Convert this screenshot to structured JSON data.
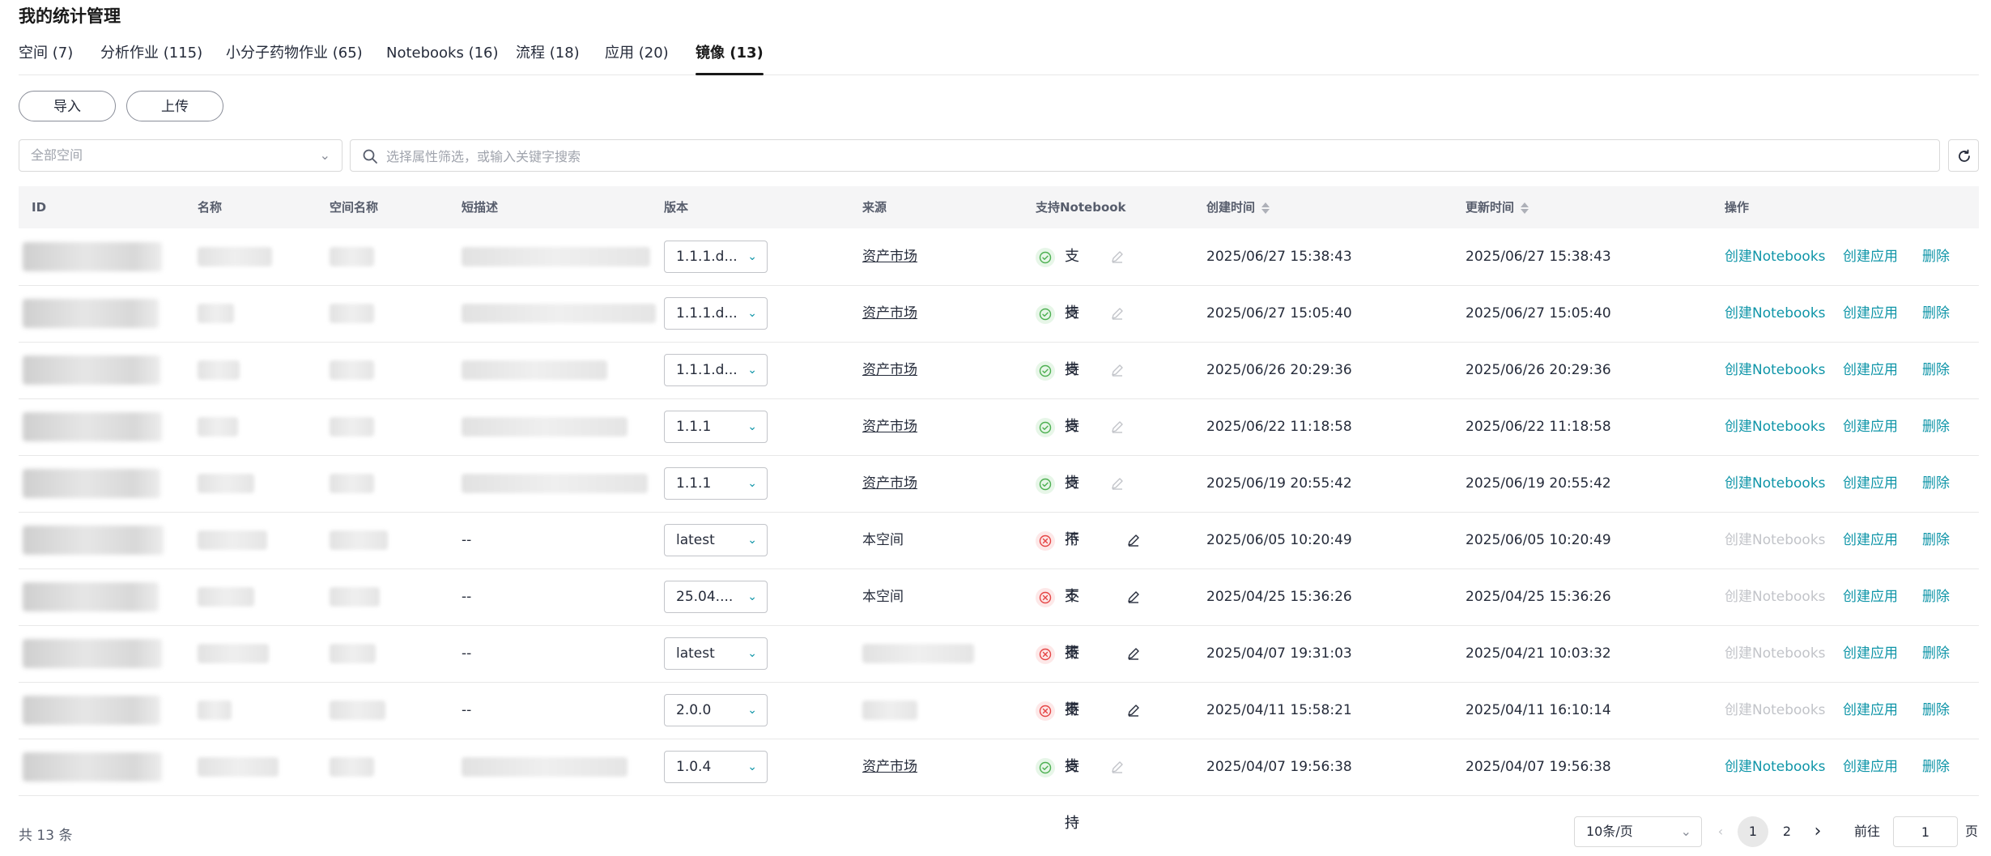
{
  "page": {
    "title": "我的统计管理"
  },
  "tabs": [
    {
      "label": "空间 (7)"
    },
    {
      "label": "分析作业 (115)"
    },
    {
      "label": "小分子药物作业 (65)"
    },
    {
      "label": "Notebooks (16)"
    },
    {
      "label": "流程 (18)"
    },
    {
      "label": "应用 (20)"
    },
    {
      "label": "镜像 (13)",
      "active": true
    }
  ],
  "toolbar": {
    "import_label": "导入",
    "upload_label": "上传"
  },
  "filters": {
    "space_placeholder": "全部空间",
    "search_placeholder": "选择属性筛选，或输入关键字搜索"
  },
  "table": {
    "headers": {
      "id": "ID",
      "name": "名称",
      "space": "空间名称",
      "desc": "短描述",
      "version": "版本",
      "source": "来源",
      "notebook": "支持Notebook",
      "created": "创建时间",
      "updated": "更新时间",
      "ops": "操作"
    },
    "actions": {
      "create_notebooks": "创建Notebooks",
      "create_app": "创建应用",
      "delete": "删除"
    },
    "rows": [
      {
        "desc": "",
        "version": "1.1.1.d...",
        "source": "资产市场",
        "source_link": true,
        "supported": true,
        "notebook": "支持",
        "created": "2025/06/27 15:38:43",
        "updated": "2025/06/27 15:38:43"
      },
      {
        "desc": "",
        "version": "1.1.1.d...",
        "source": "资产市场",
        "source_link": true,
        "supported": true,
        "notebook": "支持",
        "created": "2025/06/27 15:05:40",
        "updated": "2025/06/27 15:05:40"
      },
      {
        "desc": "",
        "version": "1.1.1.d...",
        "source": "资产市场",
        "source_link": true,
        "supported": true,
        "notebook": "支持",
        "created": "2025/06/26 20:29:36",
        "updated": "2025/06/26 20:29:36"
      },
      {
        "desc": "",
        "version": "1.1.1",
        "source": "资产市场",
        "source_link": true,
        "supported": true,
        "notebook": "支持",
        "created": "2025/06/22 11:18:58",
        "updated": "2025/06/22 11:18:58"
      },
      {
        "desc": "",
        "version": "1.1.1",
        "source": "资产市场",
        "source_link": true,
        "supported": true,
        "notebook": "支持",
        "created": "2025/06/19 20:55:42",
        "updated": "2025/06/19 20:55:42"
      },
      {
        "desc": "--",
        "version": "latest",
        "source": "本空间",
        "source_link": false,
        "supported": false,
        "notebook": "不支持",
        "created": "2025/06/05 10:20:49",
        "updated": "2025/06/05 10:20:49"
      },
      {
        "desc": "--",
        "version": "25.04....",
        "source": "本空间",
        "source_link": false,
        "supported": false,
        "notebook": "不支持",
        "created": "2025/04/25 15:36:26",
        "updated": "2025/04/25 15:36:26"
      },
      {
        "desc": "--",
        "version": "latest",
        "source": "",
        "source_link": false,
        "supported": false,
        "notebook": "不支持",
        "created": "2025/04/07 19:31:03",
        "updated": "2025/04/21 10:03:32"
      },
      {
        "desc": "--",
        "version": "2.0.0",
        "source": "",
        "source_link": false,
        "supported": false,
        "notebook": "不支持",
        "created": "2025/04/11 15:58:21",
        "updated": "2025/04/11 16:10:14"
      },
      {
        "desc": "",
        "version": "1.0.4",
        "source": "资产市场",
        "source_link": true,
        "supported": true,
        "notebook": "支持",
        "created": "2025/04/07 19:56:38",
        "updated": "2025/04/07 19:56:38"
      }
    ]
  },
  "pagination": {
    "total": "共 13 条",
    "page_size": "10条/页",
    "pages": [
      "1",
      "2"
    ],
    "current": "1",
    "goto_label": "前往",
    "goto_value": "1",
    "page_suffix": "页"
  },
  "colors": {
    "accent": "#0f95a8",
    "success": "#4caf50",
    "danger": "#e54545",
    "disabled": "#c2c4c9"
  },
  "icons": [
    "search-icon",
    "refresh-icon",
    "chevron-down-icon",
    "check-circle-icon",
    "close-circle-icon",
    "edit-icon",
    "chevron-left-icon",
    "chevron-right-icon",
    "sort-icon"
  ]
}
